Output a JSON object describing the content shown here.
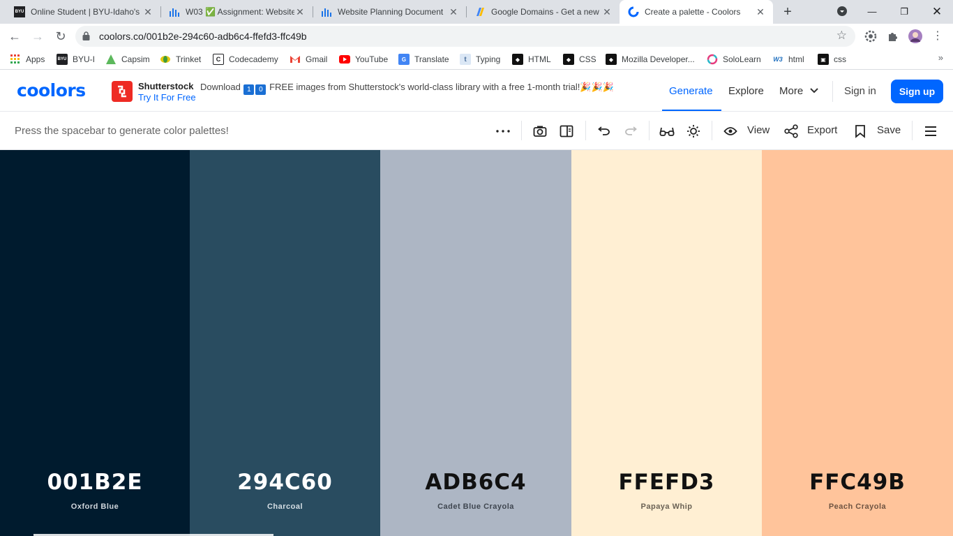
{
  "browser": {
    "tabs": [
      {
        "title": "Online Student | BYU-Idaho's",
        "icon": "byui-icon"
      },
      {
        "title": "W03 ✅ Assignment: Website",
        "icon": "chart-icon"
      },
      {
        "title": "Website Planning Document",
        "icon": "chart-icon"
      },
      {
        "title": "Google Domains - Get a new",
        "icon": "google-domains-icon"
      },
      {
        "title": "Create a palette - Coolors",
        "icon": "coolors-icon"
      }
    ],
    "url": "coolors.co/001b2e-294c60-adb6c4-ffefd3-ffc49b",
    "bookmarks": [
      {
        "label": "Apps",
        "icon": "apps-grid-icon",
        "color": "#4285f4"
      },
      {
        "label": "BYU-I",
        "icon": "byui-icon",
        "color": "#202124"
      },
      {
        "label": "Capsim",
        "icon": "capsim-icon",
        "color": "#5cb85c"
      },
      {
        "label": "Trinket",
        "icon": "trinket-icon",
        "color": "#e5c80e"
      },
      {
        "label": "Codecademy",
        "icon": "codecademy-icon",
        "color": "#202124"
      },
      {
        "label": "Gmail",
        "icon": "gmail-icon",
        "color": "#ea4335"
      },
      {
        "label": "YouTube",
        "icon": "youtube-icon",
        "color": "#ff0000"
      },
      {
        "label": "Translate",
        "icon": "translate-icon",
        "color": "#4285f4"
      },
      {
        "label": "Typing",
        "icon": "typing-icon",
        "color": "#6f9bd1"
      },
      {
        "label": "HTML",
        "icon": "html-icon",
        "color": "#111111"
      },
      {
        "label": "CSS",
        "icon": "css-icon",
        "color": "#111111"
      },
      {
        "label": "Mozilla Developer...",
        "icon": "mdn-icon",
        "color": "#111111"
      },
      {
        "label": "SoloLearn",
        "icon": "sololearn-icon",
        "color": "#e63c7e"
      },
      {
        "label": "html",
        "icon": "w3schools-icon",
        "color": "#1f6fbf"
      },
      {
        "label": "css",
        "icon": "css-icon",
        "color": "#111111"
      }
    ],
    "more": "»"
  },
  "header": {
    "logo": "coolors",
    "ad": {
      "brand": "Shutterstock",
      "text_before": "Download",
      "digits": [
        "1",
        "0"
      ],
      "text_after": "FREE images from Shutterstock's world-class library with a free 1-month trial!🎉🎉🎉",
      "link": "Try It For Free"
    },
    "nav": {
      "generate": "Generate",
      "explore": "Explore",
      "more": "More",
      "signin": "Sign in",
      "signup": "Sign up"
    },
    "accent": "#0066ff"
  },
  "toolbar": {
    "hint": "Press the spacebar to generate color palettes!",
    "view": "View",
    "export": "Export",
    "save": "Save"
  },
  "palette": [
    {
      "hex": "001B2E",
      "name": "Oxford Blue",
      "color": "#001b2e",
      "text": "#ffffff",
      "sub": "#d0d6dc"
    },
    {
      "hex": "294C60",
      "name": "Charcoal",
      "color": "#294c60",
      "text": "#ffffff",
      "sub": "#d6dfe5"
    },
    {
      "hex": "ADB6C4",
      "name": "Cadet Blue Crayola",
      "color": "#adb6c4",
      "text": "#111111",
      "sub": "#3f4650"
    },
    {
      "hex": "FFEFD3",
      "name": "Papaya Whip",
      "color": "#ffefd3",
      "text": "#111111",
      "sub": "#6a6255"
    },
    {
      "hex": "FFC49B",
      "name": "Peach Crayola",
      "color": "#ffc49b",
      "text": "#111111",
      "sub": "#6e5442"
    }
  ]
}
